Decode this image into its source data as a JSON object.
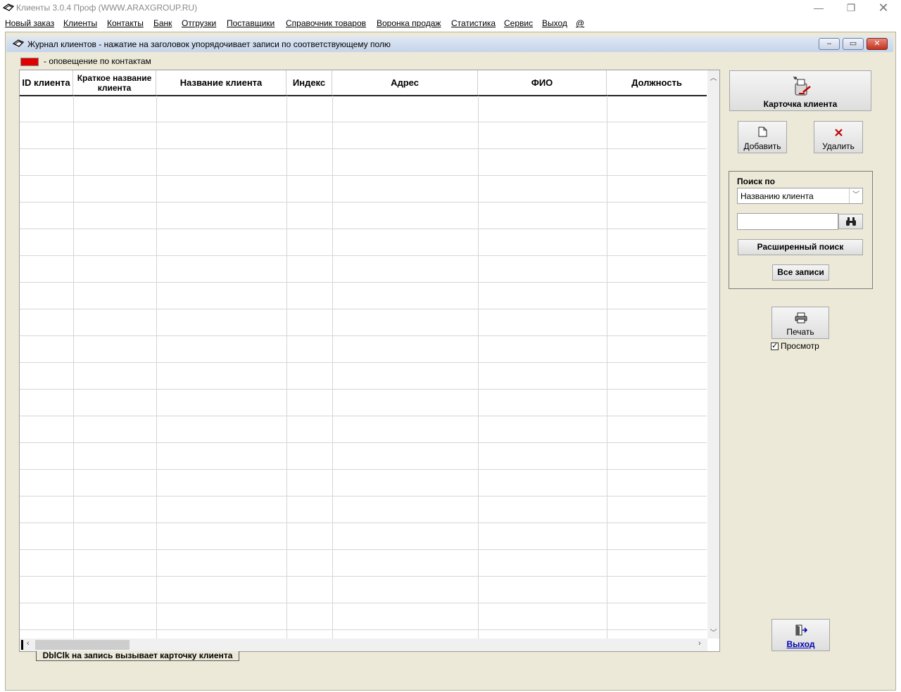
{
  "window": {
    "title": "Клиенты 3.0.4 Проф (WWW.ARAXGROUP.RU)",
    "minimize": "—",
    "maximize": "❐",
    "close": "✕"
  },
  "menu": [
    "Новый заказ",
    "Клиенты",
    "Контакты",
    "Банк",
    "Отгрузки",
    "Поставщики",
    "Справочник товаров",
    "Воронка продаж",
    "Статистика",
    "Сервис",
    "Выход",
    "@"
  ],
  "child_window": {
    "title": "Журнал клиентов - нажатие на заголовок упорядочивает записи по соответствующему полю",
    "min": "–",
    "restore": "▭",
    "close": "✕"
  },
  "legend": {
    "text": "- оповещение по контактам",
    "color": "#e00000"
  },
  "grid": {
    "columns": [
      "ID клиента",
      "Краткое название клиента",
      "Название клиента",
      "Индекс",
      "Адрес",
      "ФИО",
      "Должность"
    ],
    "rows": []
  },
  "hint": "DblClk на запись вызывает карточку клиента",
  "buttons": {
    "card": "Карточка клиента",
    "add": "Добавить",
    "delete": "Удалить",
    "print": "Печать",
    "exit": "Выход",
    "advanced_search": "Расширенный поиск",
    "all_records": "Все записи"
  },
  "search": {
    "label": "Поиск по",
    "field": "Названию клиента",
    "value": ""
  },
  "preview": {
    "label": "Просмотр",
    "checked": true
  },
  "icons": {
    "app": "stamp-icon",
    "card": "user-card-icon",
    "add": "new-document-icon",
    "delete": "red-x-icon",
    "find": "binoculars-icon",
    "print": "printer-icon",
    "exit": "exit-door-icon"
  }
}
